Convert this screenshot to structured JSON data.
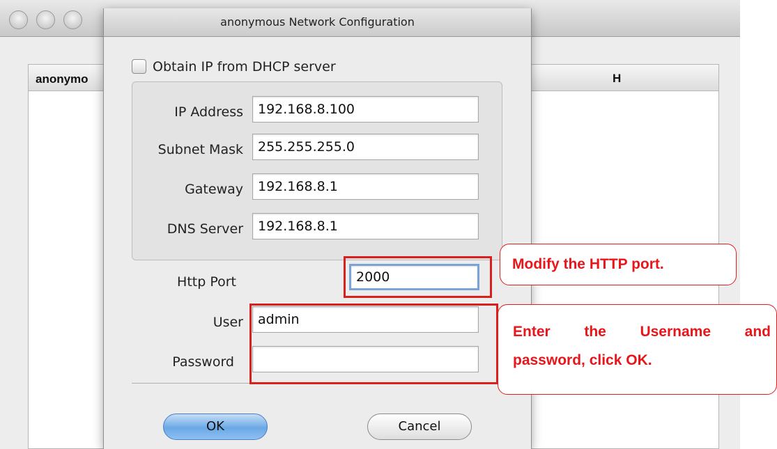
{
  "background_window": {
    "column_1_header": "anonymo",
    "column_2_header": "H"
  },
  "dialog": {
    "title": "anonymous Network Configuration",
    "dhcp_label": "Obtain IP from DHCP server",
    "dhcp_checked": false,
    "fields": {
      "ip_address": {
        "label": "IP Address",
        "value": "192.168.8.100"
      },
      "subnet_mask": {
        "label": "Subnet Mask",
        "value": "255.255.255.0"
      },
      "gateway": {
        "label": "Gateway",
        "value": "192.168.8.1"
      },
      "dns_server": {
        "label": "DNS Server",
        "value": "192.168.8.1"
      },
      "http_port": {
        "label": "Http Port",
        "value": "2000"
      },
      "user": {
        "label": "User",
        "value": "admin"
      },
      "password": {
        "label": "Password",
        "value": ""
      }
    },
    "ok_label": "OK",
    "cancel_label": "Cancel"
  },
  "annotations": {
    "http_port_note": "Modify the HTTP port.",
    "credentials_note_line1": "Enter the Username and",
    "credentials_note_line2": "password, click OK."
  },
  "colors": {
    "annotation_red": "#e8161a",
    "ok_button_blue": "#6aa8e6",
    "focus_ring": "#7aa4d8"
  }
}
